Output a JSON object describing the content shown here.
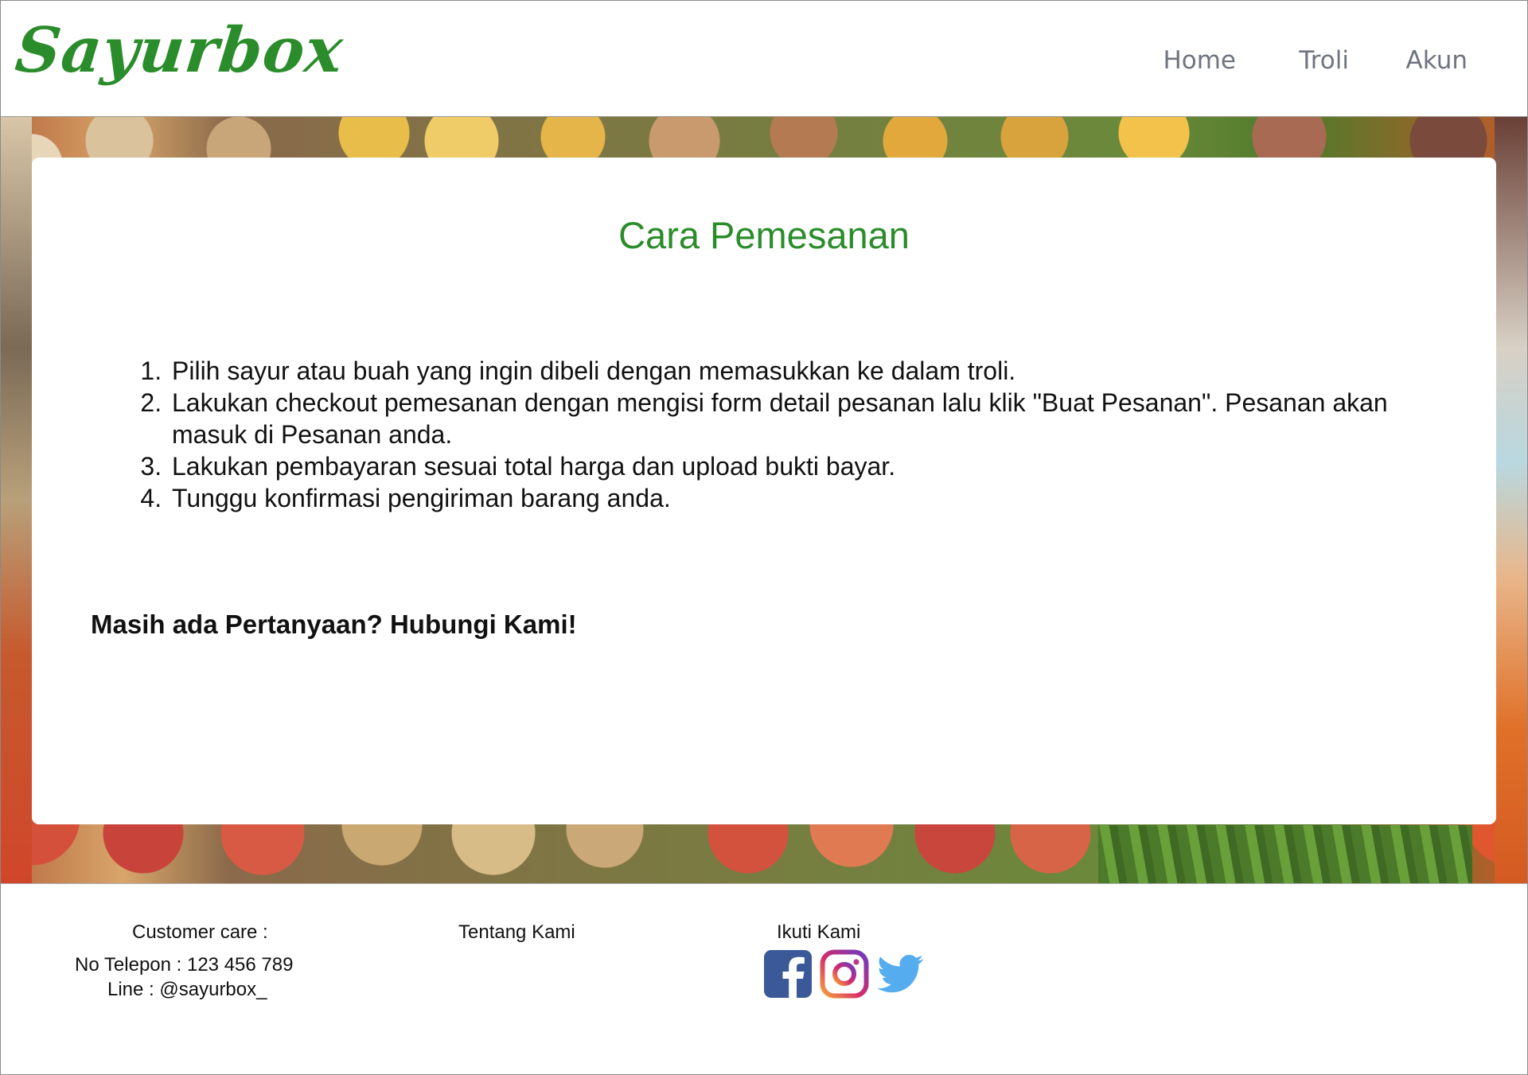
{
  "header": {
    "logo": "Sayurbox",
    "nav": [
      "Home",
      "Troli",
      "Akun"
    ]
  },
  "main": {
    "title": "Cara Pemesanan",
    "steps": [
      "Pilih sayur atau buah yang ingin dibeli dengan memasukkan ke dalam troli.",
      "Lakukan checkout pemesanan dengan mengisi form detail pesanan lalu klik \"Buat Pesanan\". Pesanan akan masuk di Pesanan anda.",
      "Lakukan pembayaran sesuai total harga dan upload bukti bayar.",
      "Tunggu konfirmasi pengiriman barang anda."
    ],
    "cta": "Masih ada Pertanyaan? Hubungi Kami!"
  },
  "footer": {
    "customer_care": "Customer care :",
    "phone": "No Telepon : 123 456 789",
    "line": "Line : @sayurbox_",
    "about": "Tentang Kami",
    "follow": "Ikuti Kami",
    "social_icons": [
      "facebook-icon",
      "instagram-icon",
      "twitter-icon"
    ]
  },
  "colors": {
    "brand_green": "#2a8c2a",
    "nav_gray": "#6e7480",
    "facebook": "#3b5998",
    "twitter": "#55acee"
  }
}
